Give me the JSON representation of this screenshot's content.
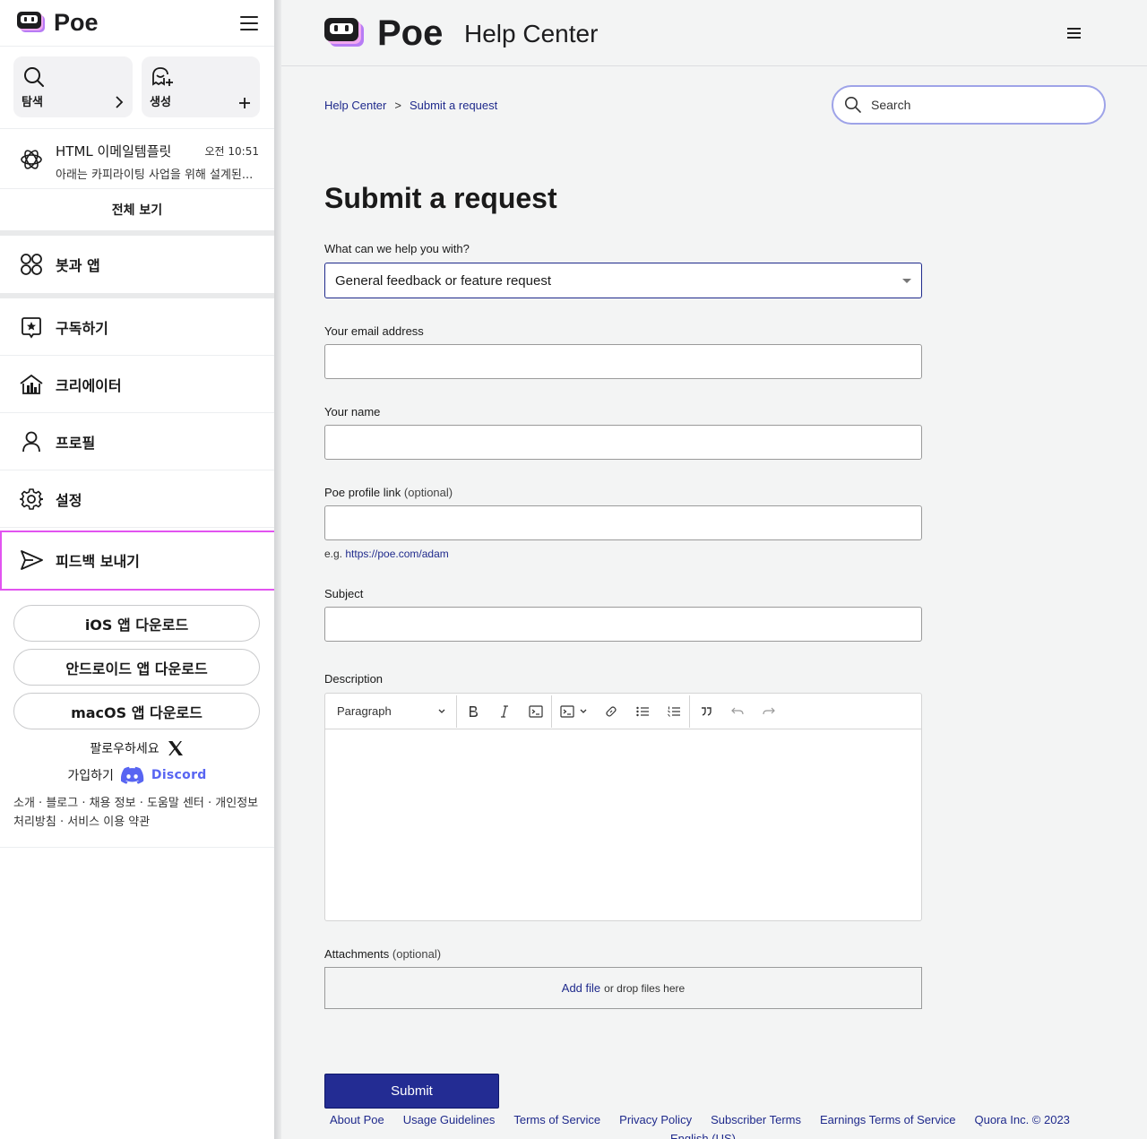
{
  "sidebar": {
    "logo_text": "Poe",
    "explore_label": "탐색",
    "create_label": "생성",
    "chat": {
      "title": "HTML 이메일템플릿",
      "time": "오전 10:51",
      "preview": "아래는 카피라이팅 사업을 위해 설계된..."
    },
    "view_all": "전체 보기",
    "nav": {
      "bots": "봇과 앱",
      "subscribe": "구독하기",
      "creators": "크리에이터",
      "profile": "프로필",
      "settings": "설정",
      "feedback": "피드백 보내기"
    },
    "downloads": {
      "ios": "iOS 앱 다운로드",
      "android": "안드로이드 앱 다운로드",
      "macos": "macOS 앱 다운로드"
    },
    "follow_label": "팔로우하세요",
    "join_label": "가입하기",
    "discord_label": "Discord",
    "footer_links": "소개 · 블로그 · 채용 정보 · 도움말 센터 · 개인정보 처리방침 · 서비스 이용 약관",
    "highlight_color": "#e254f0"
  },
  "help": {
    "logo_text": "Poe",
    "center_title": "Help Center",
    "breadcrumb": {
      "home": "Help Center",
      "sep": ">",
      "current": "Submit a request"
    },
    "search_placeholder": "Search",
    "page_title": "Submit a request",
    "form": {
      "topic_label": "What can we help you with?",
      "topic_value": "General feedback or feature request",
      "email_label": "Your email address",
      "email_value": "",
      "name_label": "Your name",
      "name_value": "",
      "profile_label": "Poe profile link",
      "optional": "(optional)",
      "profile_value": "",
      "profile_hint_prefix": "e.g.",
      "profile_hint_link": "https://poe.com/adam",
      "subject_label": "Subject",
      "subject_value": "",
      "description_label": "Description",
      "editor_paragraph": "Paragraph",
      "attachments_label": "Attachments",
      "add_file": "Add file",
      "drop_text": "or drop files here",
      "submit": "Submit"
    },
    "footer": {
      "about": "About Poe",
      "usage": "Usage Guidelines",
      "terms": "Terms of Service",
      "privacy": "Privacy Policy",
      "subscriber": "Subscriber Terms",
      "earnings": "Earnings Terms of Service",
      "copyright": "Quora Inc. © 2023",
      "language": "English (US)"
    },
    "accent_color": "#232c93"
  }
}
